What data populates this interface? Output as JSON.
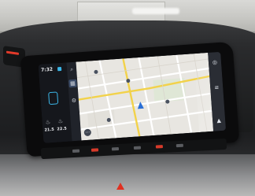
{
  "screen": {
    "clock": "7:32",
    "temp_left": "21.5",
    "temp_right": "22.5",
    "seat_icon_left": "♨",
    "seat_icon_right": "♨"
  },
  "icon_strip": [
    {
      "icon": "search-icon",
      "glyph": "⌕"
    },
    {
      "icon": "grid-icon",
      "glyph": "▦"
    },
    {
      "icon": "settings-icon",
      "glyph": "⚙"
    }
  ],
  "right_controls": [
    {
      "icon": "compass-icon",
      "glyph": "◎"
    },
    {
      "icon": "layers-icon",
      "glyph": "≡"
    },
    {
      "icon": "nav-up-icon",
      "glyph": "▲"
    }
  ],
  "colors": {
    "accent": "#3bb6e8",
    "hazard": "#e03020",
    "nav_arrow": "#2a6fd6",
    "route_yellow": "#f2d24a"
  }
}
